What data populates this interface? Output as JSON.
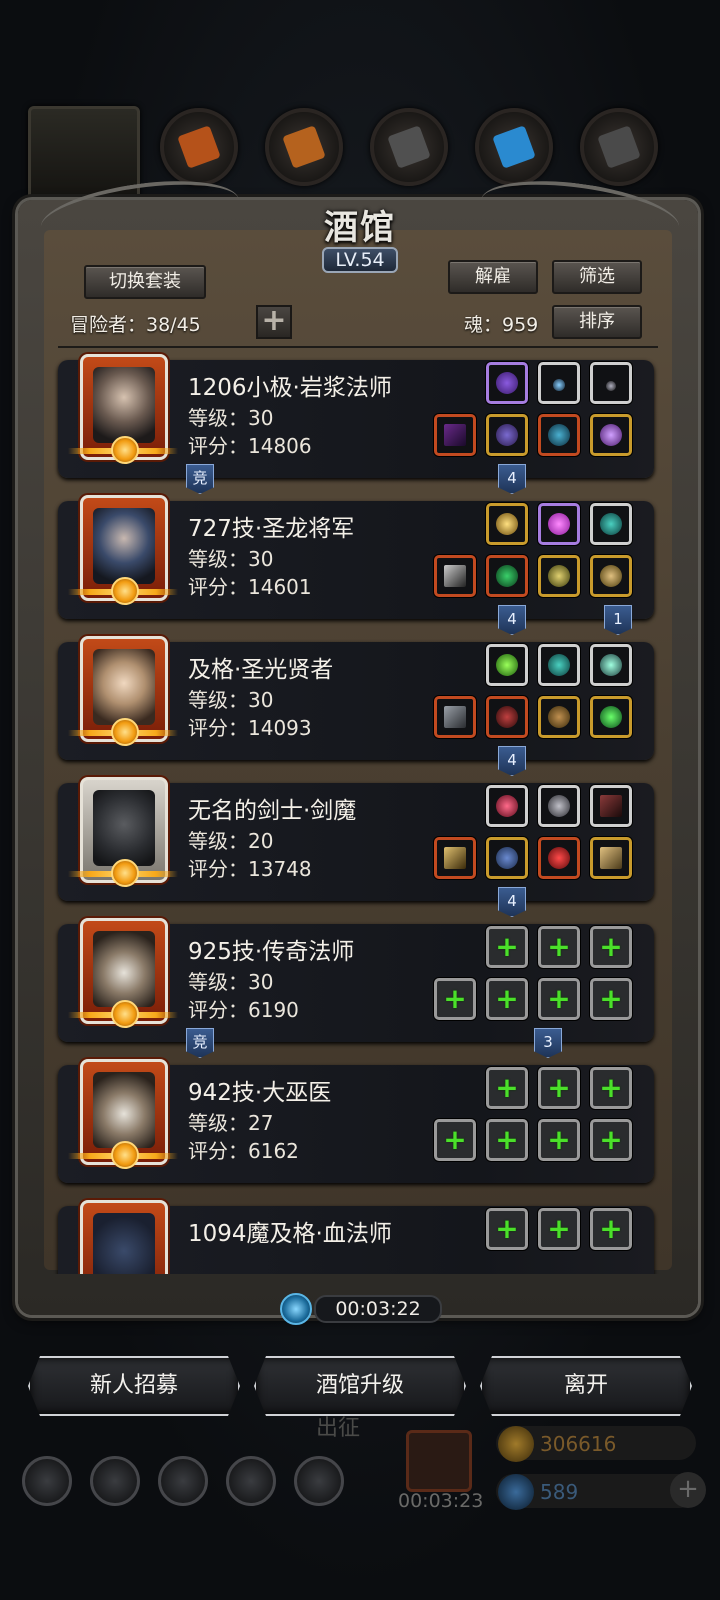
{
  "window": {
    "title": "酒馆",
    "level": "LV.54"
  },
  "toolbar": {
    "switch_set_label": "切换套装",
    "dismiss_label": "解雇",
    "filter_label": "筛选",
    "sort_label": "排序",
    "add_label": "+"
  },
  "stats": {
    "adventurers": "冒险者：38/45",
    "soul": "魂：959"
  },
  "heroes": [
    {
      "name": "1206小极·岩浆法师",
      "level": "等级：30",
      "score": "评分：14806"
    },
    {
      "name": "727技·圣龙将军",
      "level": "等级：30",
      "score": "评分：14601"
    },
    {
      "name": "及格·圣光贤者",
      "level": "等级：30",
      "score": "评分：14093"
    },
    {
      "name": "无名的剑士·剑魔",
      "level": "等级：20",
      "score": "评分：13748"
    },
    {
      "name": "925技·传奇法师",
      "level": "等级：30",
      "score": "评分：6190"
    },
    {
      "name": "942技·大巫医",
      "level": "等级：27",
      "score": "评分：6162"
    },
    {
      "name": "1094魔及格·血法师",
      "level": "",
      "score": ""
    }
  ],
  "tags": {
    "competition": "竞",
    "four": "4",
    "one": "1",
    "three": "3"
  },
  "timer": {
    "value": "00:03:22"
  },
  "buttons": {
    "recruit": "新人招募",
    "upgrade": "酒馆升级",
    "leave": "离开"
  },
  "background": {
    "expedition": "出征",
    "timer2": "00:03:23",
    "gold": "306616",
    "gems": "589"
  },
  "colors": {
    "accent_gold": "#f7a81a",
    "plus_green": "#4be02a",
    "tag_blue": "#2c4a78"
  }
}
